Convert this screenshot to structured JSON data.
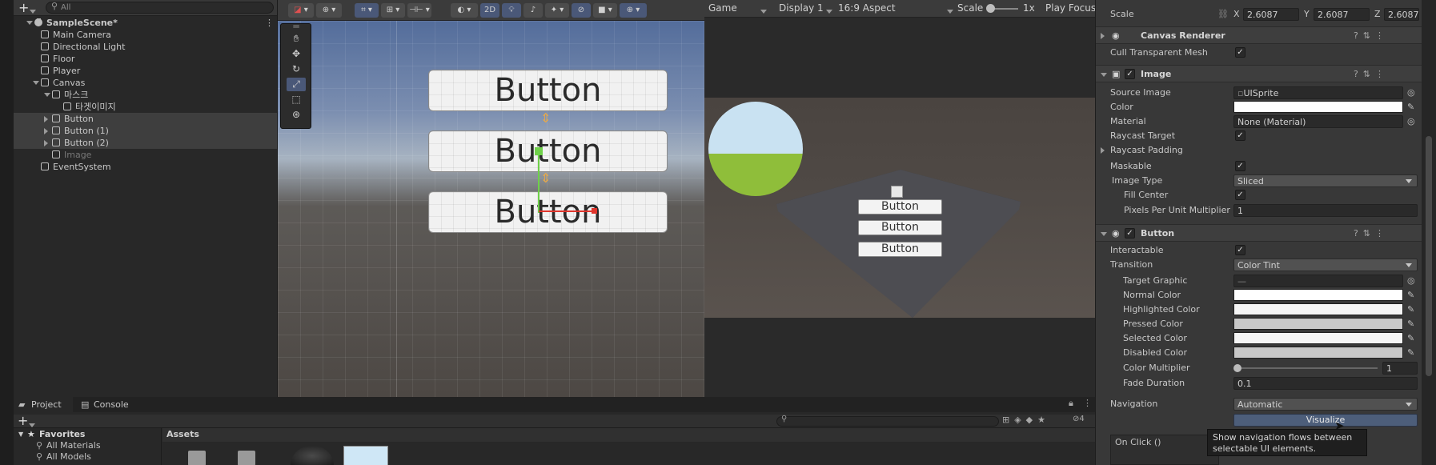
{
  "hierarchy": {
    "search_placeholder": "All",
    "add_label": "+",
    "items": [
      {
        "label": "SampleScene*",
        "depth": 0
      },
      {
        "label": "Main Camera",
        "depth": 1
      },
      {
        "label": "Directional Light",
        "depth": 1
      },
      {
        "label": "Floor",
        "depth": 1
      },
      {
        "label": "Player",
        "depth": 1
      },
      {
        "label": "Canvas",
        "depth": 1
      },
      {
        "label": "마스크",
        "depth": 2
      },
      {
        "label": "타겟이미지",
        "depth": 3
      },
      {
        "label": "Button",
        "depth": 2
      },
      {
        "label": "Button (1)",
        "depth": 2
      },
      {
        "label": "Button (2)",
        "depth": 2
      },
      {
        "label": "Image",
        "depth": 2
      },
      {
        "label": "EventSystem",
        "depth": 1
      }
    ]
  },
  "scene": {
    "toolbar_2d": "2D",
    "buttons": [
      "Button",
      "Button",
      "Button"
    ]
  },
  "game": {
    "tab": "Game",
    "display": "Display 1",
    "aspect": "16:9 Aspect",
    "scale_label": "Scale",
    "scale_value": "1x",
    "play_mode": "Play Focused",
    "buttons": [
      "Button",
      "Button",
      "Button"
    ]
  },
  "inspector": {
    "scale": {
      "label": "Scale",
      "x_label": "X",
      "x": "2.6087",
      "y_label": "Y",
      "y": "2.6087",
      "z_label": "Z",
      "z": "2.6087"
    },
    "canvas_renderer": {
      "title": "Canvas Renderer",
      "cull_label": "Cull Transparent Mesh"
    },
    "image": {
      "title": "Image",
      "source_image_label": "Source Image",
      "source_image": "UISprite",
      "color_label": "Color",
      "color": "#ffffff",
      "material_label": "Material",
      "material": "None (Material)",
      "raycast_target_label": "Raycast Target",
      "raycast_padding_label": "Raycast Padding",
      "maskable_label": "Maskable",
      "image_type_label": "Image Type",
      "image_type": "Sliced",
      "fill_center_label": "Fill Center",
      "ppu_label": "Pixels Per Unit Multiplier",
      "ppu": "1"
    },
    "button": {
      "title": "Button",
      "interactable_label": "Interactable",
      "transition_label": "Transition",
      "transition": "Color Tint",
      "target_graphic_label": "Target Graphic",
      "target_graphic": "—",
      "normal_label": "Normal Color",
      "normal": "#ffffff",
      "highlighted_label": "Highlighted Color",
      "highlighted": "#f5f5f5",
      "pressed_label": "Pressed Color",
      "pressed": "#c8c8c8",
      "selected_label": "Selected Color",
      "selected": "#f5f5f5",
      "disabled_label": "Disabled Color",
      "disabled": "#c8c8c8",
      "multiplier_label": "Color Multiplier",
      "multiplier": "1",
      "fade_label": "Fade Duration",
      "fade": "0.1",
      "navigation_label": "Navigation",
      "navigation": "Automatic",
      "visualize_label": "Visualize",
      "onclick_label": "On Click ()"
    },
    "tooltip": "Show navigation flows between selectable UI elements."
  },
  "project": {
    "tab_project": "Project",
    "tab_console": "Console",
    "favorites_label": "Favorites",
    "fav_items": [
      "All Materials",
      "All Models"
    ],
    "assets_label": "Assets",
    "add_label": "+",
    "hidden_count": "4"
  }
}
